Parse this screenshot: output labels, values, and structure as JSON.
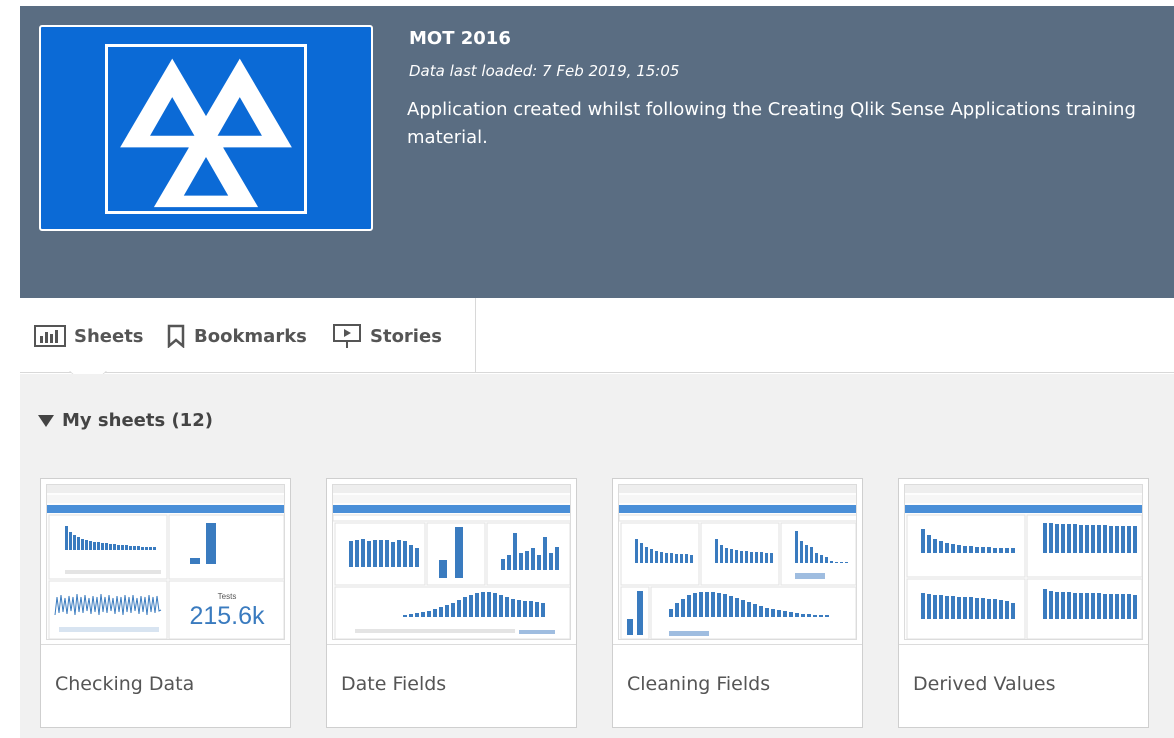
{
  "app": {
    "title": "MOT 2016",
    "loaded": "Data last loaded: 7 Feb 2019, 15:05",
    "description": "Application created whilst following the Creating Qlik Sense Applications training material.",
    "thumbnail_icon": "mot-triangles-logo",
    "thumbnail_color": "#0b6ad6"
  },
  "tabs": [
    {
      "label": "Sheets",
      "icon": "chart-icon"
    },
    {
      "label": "Bookmarks",
      "icon": "bookmark-icon"
    },
    {
      "label": "Stories",
      "icon": "presentation-icon"
    }
  ],
  "section": {
    "label": "My sheets (12)"
  },
  "sheets": [
    {
      "title": "Checking Data",
      "kpi_label": "Tests",
      "kpi_value": "215.6k"
    },
    {
      "title": "Date Fields"
    },
    {
      "title": "Cleaning Fields"
    },
    {
      "title": "Derived Values"
    }
  ],
  "colors": {
    "header": "#5a6d82",
    "bar": "#3a7bbf",
    "content_bg": "#f1f1f1"
  }
}
